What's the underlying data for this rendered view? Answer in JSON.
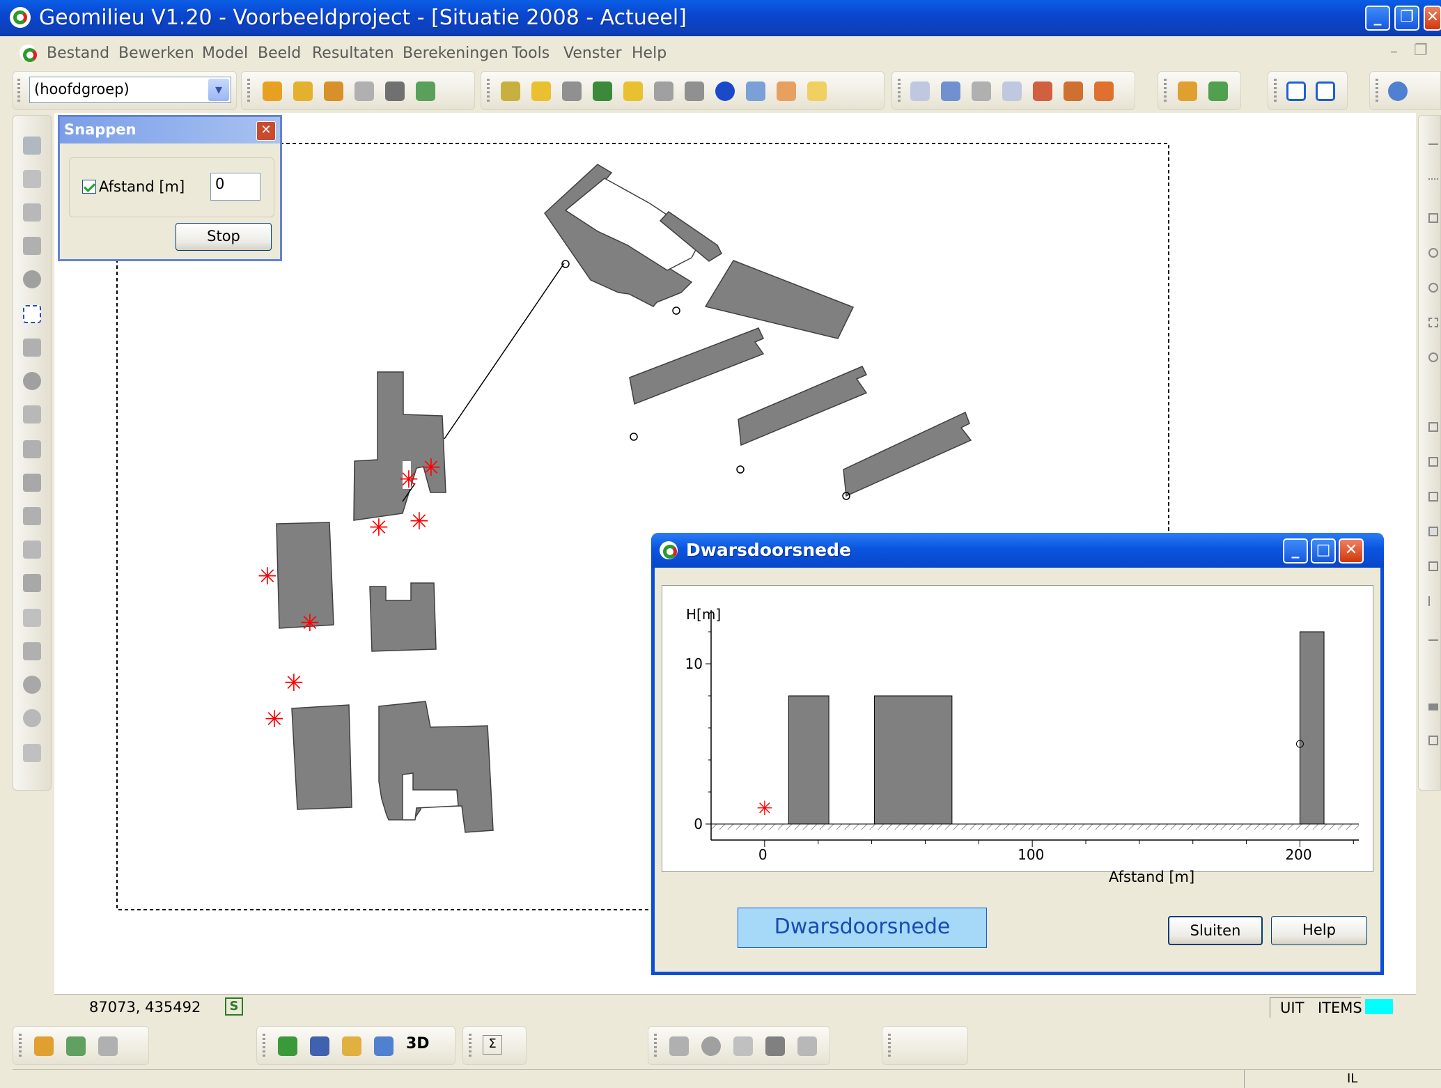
{
  "window": {
    "title": "Geomilieu V1.20 - Voorbeeldproject - [Situatie 2008 - Actueel]"
  },
  "menu": {
    "items": [
      "Bestand",
      "Bewerken",
      "Model",
      "Beeld",
      "Resultaten",
      "Berekeningen",
      "Tools",
      "Venster",
      "Help"
    ]
  },
  "toolbar": {
    "group_select": "(hoofdgroep)"
  },
  "snappen": {
    "title": "Snappen",
    "checkbox_label": "Afstand [m]",
    "checkbox_checked": true,
    "distance_value": "0",
    "stop_label": "Stop"
  },
  "dwarsdoorsnede": {
    "title": "Dwarsdoorsnede",
    "label_button": "Dwarsdoorsnede",
    "close_label": "Sluiten",
    "help_label": "Help",
    "chart": {
      "ylabel": "H[m]",
      "xlabel": "Afstand [m]",
      "y_ticks": [
        "10",
        "0"
      ],
      "x_ticks": [
        "0",
        "100",
        "200"
      ]
    }
  },
  "chart_data": {
    "type": "bar",
    "ylabel": "H[m]",
    "xlabel": "Afstand [m]",
    "xlim": [
      -20,
      222
    ],
    "ylim": [
      -1,
      14
    ],
    "bars": [
      {
        "x_start": 9,
        "x_end": 24,
        "height": 8
      },
      {
        "x_start": 41,
        "x_end": 70,
        "height": 8
      },
      {
        "x_start": 200,
        "x_end": 209,
        "height": 12
      }
    ],
    "source_points": [
      {
        "x": 0,
        "y": 1
      }
    ],
    "receiver_points": [
      {
        "x": 200,
        "y": 5
      }
    ]
  },
  "statusbar": {
    "coords": "87073, 435492",
    "uit_label": "UIT",
    "items_label": "ITEMS",
    "indicator_color": "#00ffff",
    "bottom_right": "IL"
  },
  "colors": {
    "building": "#808080",
    "source": "#ff0000",
    "titlebar": "#0a52d8"
  }
}
